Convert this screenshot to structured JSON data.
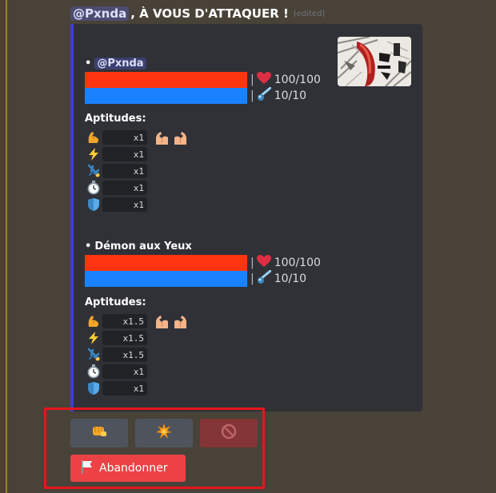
{
  "header": {
    "mention": "@Pxnda",
    "text": ", À VOUS D'ATTAQUER !",
    "edited": "(edited)"
  },
  "embed": {
    "accent_color": "#3f3cd6",
    "fighters": [
      {
        "bullet": "•",
        "name": "",
        "mention": "@Pxnda",
        "hp": "100/100",
        "mp": "10/10",
        "hp_fraction": 1.0,
        "mp_fraction": 1.0,
        "aptitudes_label": "Aptitudes:",
        "aptitudes": [
          {
            "icon": "flexed-biceps-icon",
            "value": "x1"
          },
          {
            "icon": "lightning-icon",
            "value": "x1"
          },
          {
            "icon": "cartwheel-icon",
            "value": "x1"
          },
          {
            "icon": "stopwatch-icon",
            "value": "x1"
          },
          {
            "icon": "shield-icon",
            "value": "x1"
          }
        ]
      },
      {
        "bullet": "•",
        "name": "Démon aux Yeux",
        "mention": "",
        "hp": "100/100",
        "mp": "10/10",
        "hp_fraction": 1.0,
        "mp_fraction": 1.0,
        "aptitudes_label": "Aptitudes:",
        "aptitudes": [
          {
            "icon": "flexed-biceps-icon",
            "value": "x1.5"
          },
          {
            "icon": "lightning-icon",
            "value": "x1.5"
          },
          {
            "icon": "cartwheel-icon",
            "value": "x1.5"
          },
          {
            "icon": "stopwatch-icon",
            "value": "x1"
          },
          {
            "icon": "shield-icon",
            "value": "x1"
          }
        ]
      }
    ],
    "separator": "|"
  },
  "buttons": {
    "attack": {
      "icon": "fist-icon"
    },
    "special": {
      "icon": "collision-icon"
    },
    "blocked": {
      "icon": "prohibited-icon"
    },
    "abandon": {
      "icon": "white-flag-icon",
      "label": "Abandonner"
    }
  },
  "colors": {
    "hp_bar": "#ff3410",
    "mp_bar": "#1a82ff",
    "danger_button": "#ed4245",
    "highlight": "#e5161b"
  }
}
